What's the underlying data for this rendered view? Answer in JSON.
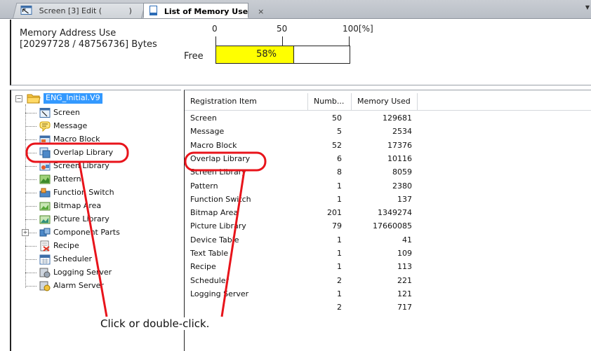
{
  "tabs": [
    {
      "label": "Screen [3] Edit (",
      "label_tail": ")",
      "active": false,
      "icon": "screen-edit-icon"
    },
    {
      "label": "List of Memory Use",
      "active": true,
      "icon": "memory-list-icon",
      "close": "×"
    }
  ],
  "memory": {
    "title": "Memory Address Use",
    "bytes": "[20297728 / 48756736] Bytes",
    "free_label": "Free",
    "percent_text": "58%",
    "percent_value": 58,
    "scale": [
      "0",
      "50",
      "100[%]"
    ]
  },
  "tree": {
    "root": {
      "label": "ENG_Initial.V9",
      "expander": "−",
      "icon": "folder-icon"
    },
    "items": [
      {
        "label": "Screen",
        "icon": "screen-icon"
      },
      {
        "label": "Message",
        "icon": "message-icon"
      },
      {
        "label": "Macro Block",
        "icon": "macro-block-icon"
      },
      {
        "label": "Overlap Library",
        "icon": "overlap-library-icon"
      },
      {
        "label": "Screen Library",
        "icon": "screen-library-icon"
      },
      {
        "label": "Pattern",
        "icon": "pattern-icon"
      },
      {
        "label": "Function Switch",
        "icon": "function-switch-icon"
      },
      {
        "label": "Bitmap Area",
        "icon": "bitmap-area-icon"
      },
      {
        "label": "Picture Library",
        "icon": "picture-library-icon"
      },
      {
        "label": "Component Parts",
        "icon": "component-parts-icon",
        "expander": "+"
      },
      {
        "label": "Recipe",
        "icon": "recipe-icon"
      },
      {
        "label": "Scheduler",
        "icon": "scheduler-icon"
      },
      {
        "label": "Logging Server",
        "icon": "logging-server-icon"
      },
      {
        "label": "Alarm Server",
        "icon": "alarm-server-icon"
      }
    ]
  },
  "table": {
    "headers": [
      "Registration Item",
      "Numb...",
      "Memory Used"
    ],
    "rows": [
      {
        "item": "Screen",
        "number": "50",
        "memory": "129681"
      },
      {
        "item": "Message",
        "number": "5",
        "memory": "2534"
      },
      {
        "item": "Macro Block",
        "number": "52",
        "memory": "17376"
      },
      {
        "item": "Overlap Library",
        "number": "6",
        "memory": "10116"
      },
      {
        "item": "Screen Library",
        "number": "8",
        "memory": "8059"
      },
      {
        "item": "Pattern",
        "number": "1",
        "memory": "2380"
      },
      {
        "item": "Function Switch",
        "number": "1",
        "memory": "137"
      },
      {
        "item": "Bitmap Area",
        "number": "201",
        "memory": "1349274"
      },
      {
        "item": "Picture Library",
        "number": "79",
        "memory": "17660085"
      },
      {
        "item": "Device Table",
        "number": "1",
        "memory": "41"
      },
      {
        "item": "Text Table",
        "number": "1",
        "memory": "109"
      },
      {
        "item": "Recipe",
        "number": "1",
        "memory": "113"
      },
      {
        "item": "Scheduler",
        "number": "2",
        "memory": "221"
      },
      {
        "item": "Logging Server",
        "number": "1",
        "memory": "121"
      },
      {
        "item": "",
        "number": "2",
        "memory": "717"
      }
    ]
  },
  "annotation": {
    "caption": "Click or double-click.",
    "color": "#e8141b"
  },
  "colors": {
    "selection": "#3399ff",
    "bar_fill": "#ffff00"
  }
}
